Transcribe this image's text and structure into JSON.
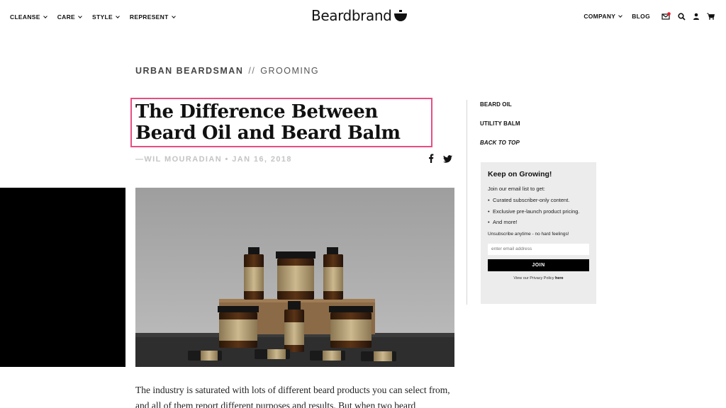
{
  "nav": {
    "left": [
      {
        "label": "CLEANSE"
      },
      {
        "label": "CARE"
      },
      {
        "label": "STYLE"
      },
      {
        "label": "REPRESENT"
      }
    ],
    "logo": "Beardbrand",
    "right": [
      {
        "label": "COMPANY"
      },
      {
        "label": "BLOG"
      }
    ],
    "icons": [
      "mail-icon",
      "search-icon",
      "account-icon",
      "cart-icon"
    ],
    "notification_color": "#e8192c"
  },
  "article": {
    "category_primary": "URBAN BEARDSMAN",
    "category_sep": "//",
    "category_secondary": "GROOMING",
    "title": "The Difference Between Beard Oil and Beard Balm",
    "byline": "—WIL MOURADIAN • JAN 16, 2018",
    "share_icons": [
      "facebook-icon",
      "twitter-icon"
    ],
    "body": "The industry is saturated with lots of different beard products you can select from, and all of them report different purposes and results. But when two beard",
    "highlight_color": "#e94c83"
  },
  "sidebar": {
    "toc": [
      {
        "label": "BEARD OIL"
      },
      {
        "label": "UTILITY BALM"
      },
      {
        "label": "BACK TO TOP"
      }
    ],
    "signup": {
      "heading": "Keep on Growing!",
      "intro": "Join our email list to get:",
      "bullets": [
        "Curated subscriber-only content.",
        "Exclusive pre-launch product pricing.",
        "And more!"
      ],
      "unsubscribe": "Unsubscribe anytime - no hard feelings!",
      "email_placeholder": "enter email address",
      "join_label": "JOIN",
      "privacy_prefix": "View our Privacy Policy",
      "privacy_link": "here"
    }
  }
}
